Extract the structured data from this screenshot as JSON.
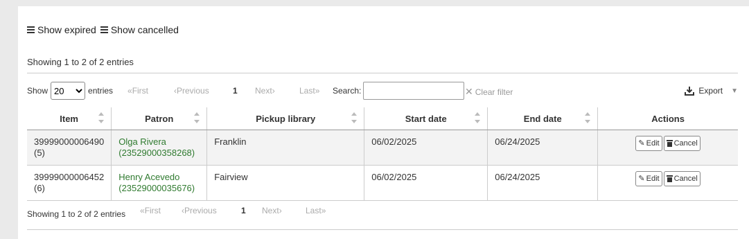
{
  "toolbar": {
    "show_expired": "Show expired",
    "show_cancelled": "Show cancelled"
  },
  "info_top": "Showing 1 to 2 of 2 entries",
  "info_bottom": "Showing 1 to 2 of 2 entries",
  "length": {
    "show_label": "Show",
    "selected": "20",
    "entries_label": "entries"
  },
  "pager": {
    "first": "First",
    "previous": "Previous",
    "current": "1",
    "next": "Next",
    "last": "Last"
  },
  "search": {
    "label": "Search:",
    "value": ""
  },
  "clear_filter": "Clear filter",
  "export": "Export",
  "table": {
    "headers": [
      "Item",
      "Patron",
      "Pickup library",
      "Start date",
      "End date",
      "Actions"
    ],
    "rows": [
      {
        "item_barcode": "39999000006490",
        "item_num": "(5)",
        "patron_name": "Olga Rivera",
        "patron_card": "(23529000358268)",
        "pickup": "Franklin",
        "start": "06/02/2025",
        "end": "06/24/2025"
      },
      {
        "item_barcode": "39999000006452",
        "item_num": "(6)",
        "patron_name": "Henry Acevedo",
        "patron_card": "(23529000035676)",
        "pickup": "Fairview",
        "start": "06/02/2025",
        "end": "06/24/2025"
      }
    ],
    "edit_label": "Edit",
    "cancel_label": "Cancel"
  },
  "icons": {
    "toolbar": "list-icon",
    "first": "double-chevron-left-icon",
    "previous": "chevron-left-icon",
    "next": "chevron-right-icon",
    "last": "double-chevron-right-icon",
    "clear": "x-icon",
    "export": "download-icon",
    "edit": "pencil-icon",
    "cancel": "trash-icon"
  },
  "colors": {
    "patron_link": "#2f7a2f",
    "disabled": "#aaaaaa",
    "row_alt": "#f3f3f3"
  }
}
